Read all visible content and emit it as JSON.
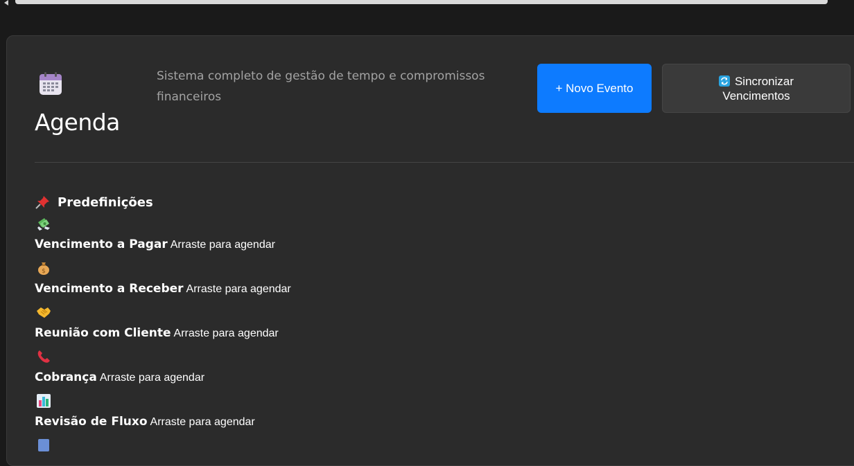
{
  "header": {
    "title": "Agenda",
    "subtitle": "Sistema completo de gestão de tempo e compromissos financeiros",
    "new_event_label": "+ Novo Evento",
    "sync_label": "Sincronizar Vencimentos",
    "icon": "calendar-icon",
    "sync_icon": "sync-icon",
    "accent_color": "#0d7bff"
  },
  "presets": {
    "title": "Predefinições",
    "title_icon": "pushpin-icon",
    "items": [
      {
        "name": "Vencimento a Pagar",
        "hint": "Arraste para agendar",
        "icon": "money-with-wings-icon"
      },
      {
        "name": "Vencimento a Receber",
        "hint": "Arraste para agendar",
        "icon": "money-bag-icon"
      },
      {
        "name": "Reunião com Cliente",
        "hint": "Arraste para agendar",
        "icon": "handshake-icon"
      },
      {
        "name": "Cobrança",
        "hint": "Arraste para agendar",
        "icon": "telephone-receiver-icon"
      },
      {
        "name": "Revisão de Fluxo",
        "hint": "Arraste para agendar",
        "icon": "bar-chart-icon"
      }
    ]
  }
}
